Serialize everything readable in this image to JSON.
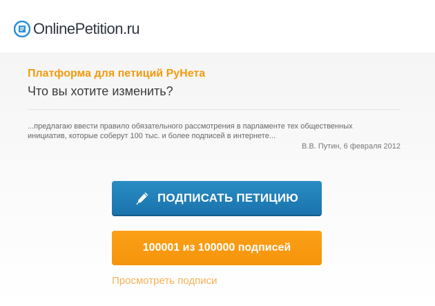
{
  "header": {
    "logo_text": "OnlinePetition.ru",
    "logo_icon": "document-list-icon"
  },
  "hero": {
    "tagline": "Платформа для петиций РуНета",
    "question": "Что вы хотите изменить?"
  },
  "quote": {
    "text": "...предлагаю ввести правило обязательного рассмотрения в парламенте тех общественных инициатив, которые соберут 100 тыс. и более подписей в интернете...",
    "author": "В.В. Путин, 6 февраля 2012"
  },
  "actions": {
    "sign_label": "ПОДПИСАТЬ ПЕТИЦИЮ",
    "sign_icon": "pen-icon",
    "count_label": "100001 из 100000 подписей",
    "view_link": "Просмотреть подписи"
  },
  "colors": {
    "accent_orange": "#f39a0d",
    "button_blue": "#1f7fb8",
    "button_orange": "#f99c12"
  }
}
